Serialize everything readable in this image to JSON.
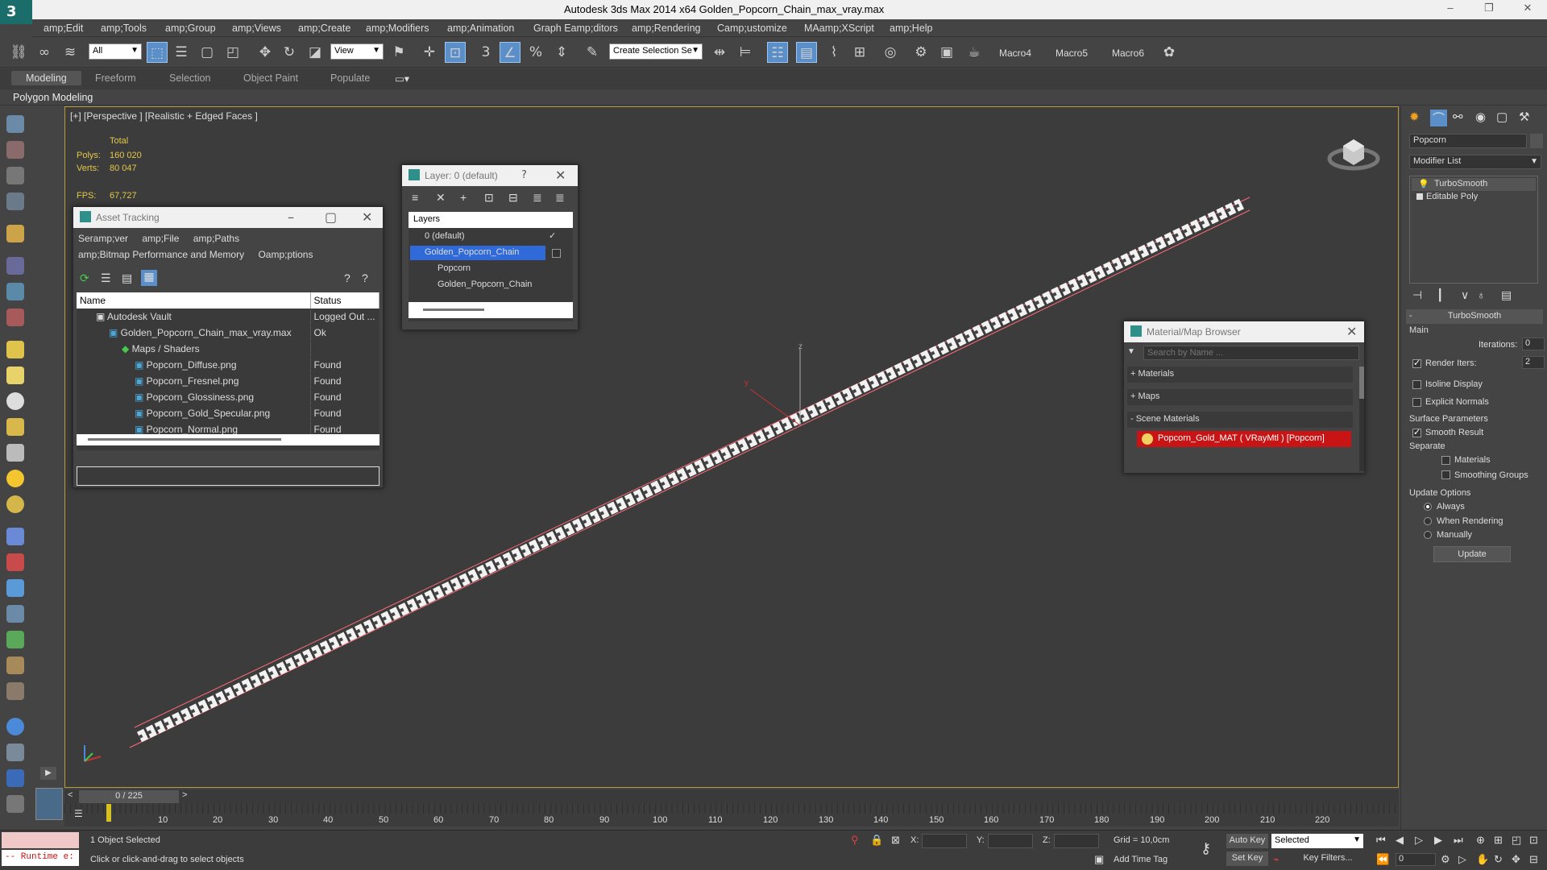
{
  "window": {
    "title": "Autodesk 3ds Max  2014 x64     Golden_Popcorn_Chain_max_vray.max",
    "logo": "3ds-max-logo-icon",
    "minimize": "–",
    "restore": "❐",
    "close": "✕"
  },
  "menu": [
    "amp;Edit",
    "amp;Tools",
    "amp;Group",
    "amp;Views",
    "amp;Create",
    "amp;Modifiers",
    "amp;Animation",
    "Graph Eamp;ditors",
    "amp;Rendering",
    "Camp;ustomize",
    "MAamp;XScript",
    "amp;Help"
  ],
  "toolbar": {
    "selection_filter": "All",
    "ref_coord": "View",
    "named_selection": "Create Selection Se",
    "macros": [
      "Macro4",
      "Macro5",
      "Macro6"
    ]
  },
  "ribbon": {
    "tabs": [
      "Modeling",
      "Freeform",
      "Selection",
      "Object Paint",
      "Populate"
    ],
    "active": "Modeling",
    "panel": "Polygon Modeling"
  },
  "viewport": {
    "label": "[+] [Perspective ] [Realistic + Edged Faces ]",
    "stats": {
      "total_label": "Total",
      "polys_label": "Polys:",
      "polys_value": "160 020",
      "verts_label": "Verts:",
      "verts_value": "80 047",
      "fps_label": "FPS:",
      "fps_value": "67,727"
    },
    "axis_labels": {
      "x": "x",
      "y": "y",
      "z": "z"
    }
  },
  "asset_tracking": {
    "title": "Asset Tracking",
    "menu": [
      "Seramp;ver",
      "amp;File",
      "amp;Paths"
    ],
    "menu2": [
      "amp;Bitmap Performance and Memory",
      "Oamp;ptions"
    ],
    "columns": [
      "Name",
      "Status"
    ],
    "rows": [
      {
        "name": "Autodesk Vault",
        "status": "Logged Out ..."
      },
      {
        "name": "Golden_Popcorn_Chain_max_vray.max",
        "status": "Ok"
      },
      {
        "name": "Maps / Shaders",
        "status": ""
      },
      {
        "name": "Popcorn_Diffuse.png",
        "status": "Found"
      },
      {
        "name": "Popcorn_Fresnel.png",
        "status": "Found"
      },
      {
        "name": "Popcorn_Glossiness.png",
        "status": "Found"
      },
      {
        "name": "Popcorn_Gold_Specular.png",
        "status": "Found"
      },
      {
        "name": "Popcorn_Normal.png",
        "status": "Found"
      }
    ]
  },
  "layer_window": {
    "title": "Layer: 0 (default)",
    "help": "?",
    "column": "Layers",
    "items": [
      "0 (default)",
      "Golden_Popcorn_Chain",
      "Popcorn",
      "Golden_Popcorn_Chain"
    ]
  },
  "material_browser": {
    "title": "Material/Map Browser",
    "search_placeholder": "Search by Name ...",
    "sections": [
      "+ Materials",
      "+ Maps",
      "- Scene Materials"
    ],
    "scene_material": "Popcorn_Gold_MAT  ( VRayMtl )  [Popcorn]",
    "accent": "#c81414"
  },
  "command_panel": {
    "object_name": "Popcorn",
    "modifier_list": "Modifier List",
    "stack": [
      "TurboSmooth",
      "Editable Poly"
    ],
    "rollout_title": "TurboSmooth",
    "main_label": "Main",
    "iterations_label": "Iterations:",
    "iterations_value": "0",
    "render_iters_label": "Render Iters:",
    "render_iters_value": "2",
    "isoline": "Isoline Display",
    "explicit": "Explicit Normals",
    "surface_label": "Surface Parameters",
    "smooth_result": "Smooth Result",
    "separate_label": "Separate",
    "materials": "Materials",
    "smoothing_groups": "Smoothing Groups",
    "update_options": "Update Options",
    "always": "Always",
    "when_rendering": "When Rendering",
    "manually": "Manually",
    "update_button": "Update"
  },
  "timeline": {
    "frame_display": "0 / 225",
    "prev": "<",
    "next": ">",
    "ticks": [
      "10",
      "20",
      "30",
      "40",
      "50",
      "60",
      "70",
      "80",
      "90",
      "100",
      "110",
      "120",
      "130",
      "140",
      "150",
      "160",
      "170",
      "180",
      "190",
      "200",
      "210",
      "220"
    ]
  },
  "status": {
    "maxscript": "-- Runtime e:",
    "selected": "1 Object Selected",
    "prompt": "Click or click-and-drag to select objects",
    "x_label": "X:",
    "y_label": "Y:",
    "z_label": "Z:",
    "grid": "Grid = 10,0cm",
    "auto_key": "Auto Key",
    "selected_dd": "Selected",
    "set_key": "Set Key",
    "key_filters": "Key Filters...",
    "add_time_tag": "Add Time Tag",
    "frame_value": "0"
  }
}
